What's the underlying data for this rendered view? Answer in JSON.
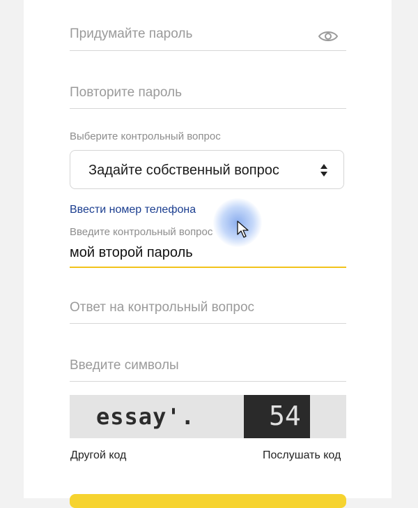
{
  "form": {
    "password_placeholder": "Придумайте пароль",
    "repeat_password_placeholder": "Повторите пароль",
    "question_label": "Выберите контрольный вопрос",
    "question_selected": "Задайте собственный вопрос",
    "phone_link": "Ввести номер телефона",
    "custom_question_label": "Введите контрольный вопрос",
    "custom_question_value": "мой второй пароль",
    "answer_placeholder": "Ответ на контрольный вопрос",
    "captcha_placeholder": "Введите символы",
    "captcha_word": "essay'.",
    "captcha_number": "54",
    "other_code_link": "Другой код",
    "listen_code_link": "Послушать код"
  },
  "colors": {
    "accent_yellow": "#f2c31b",
    "link_blue": "#1a3d8f",
    "placeholder_gray": "#9a9a9a"
  },
  "icons": {
    "password_visibility": "eye-icon",
    "select_arrows": "sort-arrows-icon",
    "pointer": "mouse-cursor-icon"
  }
}
